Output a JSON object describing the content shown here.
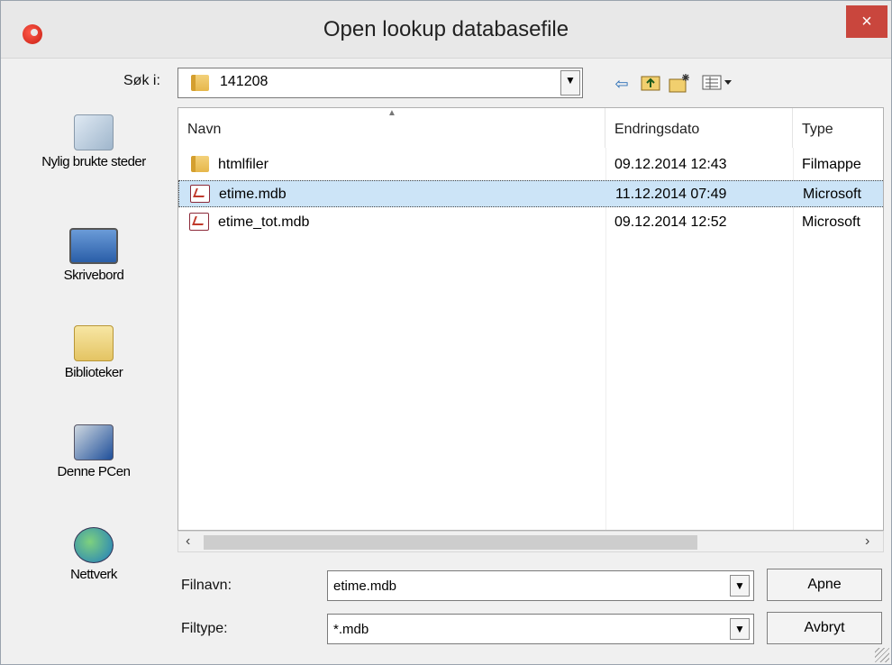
{
  "window": {
    "title": "Open lookup databasefile",
    "close_glyph": "×"
  },
  "toolbar": {
    "lookin_label": "Søk i:",
    "lookin_value": "141208",
    "icons": [
      "back-arrow-icon",
      "up-folder-icon",
      "new-folder-icon",
      "view-menu-icon"
    ]
  },
  "places": [
    {
      "label": "Nylig brukte steder",
      "icon": "recent-places-icon"
    },
    {
      "label": "Skrivebord",
      "icon": "desktop-icon"
    },
    {
      "label": "Biblioteker",
      "icon": "libraries-icon"
    },
    {
      "label": "Denne PCen",
      "icon": "this-pc-icon"
    },
    {
      "label": "Nettverk",
      "icon": "network-icon"
    }
  ],
  "columns": {
    "name": "Navn",
    "date": "Endringsdato",
    "type": "Type"
  },
  "files": [
    {
      "name": "htmlfiler",
      "date": "09.12.2014 12:43",
      "type": "Filmappe",
      "kind": "folder"
    },
    {
      "name": "etime.mdb",
      "date": "11.12.2014 07:49",
      "type": "Microsoft",
      "kind": "mdb"
    },
    {
      "name": "etime_tot.mdb",
      "date": "09.12.2014 12:52",
      "type": "Microsoft",
      "kind": "mdb"
    }
  ],
  "form": {
    "filename_label": "Filnavn:",
    "filename_value": "etime.mdb",
    "filetype_label": "Filtype:",
    "filetype_value": "*.mdb",
    "open_button": "Apne",
    "cancel_button": "Avbryt"
  }
}
